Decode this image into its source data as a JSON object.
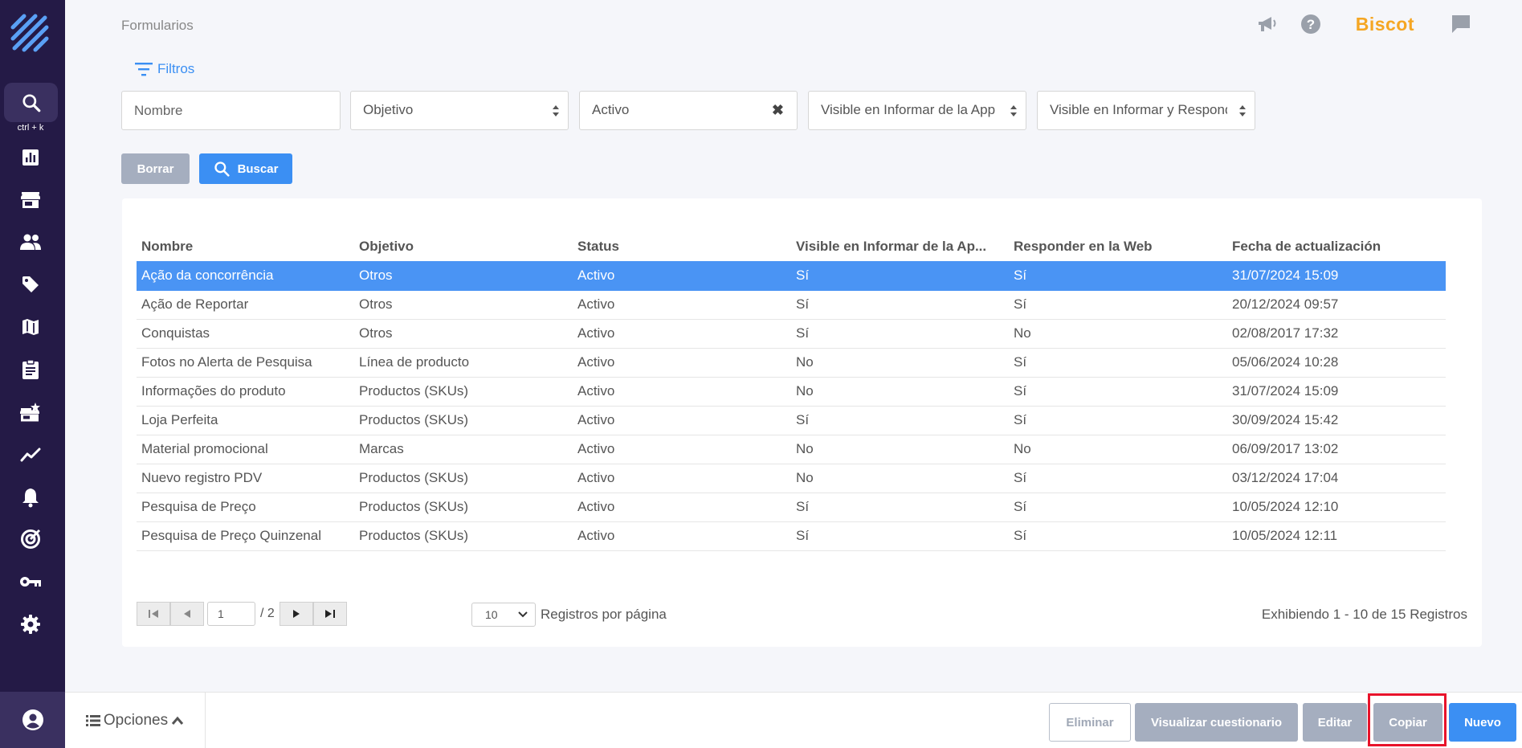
{
  "header": {
    "title": "Formularios",
    "brand": "Biscot",
    "icons": [
      "megaphone-icon",
      "help-icon",
      "chat-icon"
    ]
  },
  "sidebar": {
    "shortcut_hint": "ctrl + k",
    "items": [
      "search-icon",
      "chart-icon",
      "store-icon",
      "users-icon",
      "tag-icon",
      "map-icon",
      "clipboard-icon",
      "store-star-icon",
      "trend-icon",
      "bell-icon",
      "target-icon",
      "key-icon",
      "gear-icon",
      "account-icon"
    ]
  },
  "filters": {
    "toggle_label": "Filtros",
    "nombre_placeholder": "Nombre",
    "objetivo": "Objetivo",
    "status": "Activo",
    "visible_app": "Visible en Informar de la App",
    "visible_informar": "Visible en Informar y Responder",
    "clear_label": "Borrar",
    "search_label": "Buscar"
  },
  "table": {
    "columns": [
      "Nombre",
      "Objetivo",
      "Status",
      "Visible en Informar de la Ap...",
      "Responder en la Web",
      "Fecha de actualización"
    ],
    "rows": [
      [
        "Ação da concorrência",
        "Otros",
        "Activo",
        "Sí",
        "Sí",
        "31/07/2024 15:09"
      ],
      [
        "Ação de Reportar",
        "Otros",
        "Activo",
        "Sí",
        "Sí",
        "20/12/2024 09:57"
      ],
      [
        "Conquistas",
        "Otros",
        "Activo",
        "Sí",
        "No",
        "02/08/2017 17:32"
      ],
      [
        "Fotos no Alerta de Pesquisa",
        "Línea de producto",
        "Activo",
        "No",
        "Sí",
        "05/06/2024 10:28"
      ],
      [
        "Informações do produto",
        "Productos (SKUs)",
        "Activo",
        "No",
        "Sí",
        "31/07/2024 15:09"
      ],
      [
        "Loja Perfeita",
        "Productos (SKUs)",
        "Activo",
        "Sí",
        "Sí",
        "30/09/2024 15:42"
      ],
      [
        "Material promocional",
        "Marcas",
        "Activo",
        "No",
        "No",
        "06/09/2017 13:02"
      ],
      [
        "Nuevo registro PDV",
        "Productos (SKUs)",
        "Activo",
        "No",
        "Sí",
        "03/12/2024 17:04"
      ],
      [
        "Pesquisa de Preço",
        "Productos (SKUs)",
        "Activo",
        "Sí",
        "Sí",
        "10/05/2024 12:10"
      ],
      [
        "Pesquisa de Preço Quinzenal",
        "Productos (SKUs)",
        "Activo",
        "Sí",
        "Sí",
        "10/05/2024 12:11"
      ]
    ],
    "selected_row": 0
  },
  "pagination": {
    "current_page": "1",
    "total_pages": "/ 2",
    "per_page": "10",
    "per_page_label": "Registros por página",
    "summary": "Exhibiendo 1 - 10 de 15 Registros"
  },
  "footer": {
    "options_label": "Opciones",
    "delete_label": "Eliminar",
    "view_label": "Visualizar cuestionario",
    "edit_label": "Editar",
    "copy_label": "Copiar",
    "new_label": "Nuevo"
  },
  "colors": {
    "sidebar": "#241a46",
    "accent": "#3b8ff3",
    "selected_row": "#4a94f4",
    "highlight": "#e8132b",
    "brand": "#f5a623"
  }
}
